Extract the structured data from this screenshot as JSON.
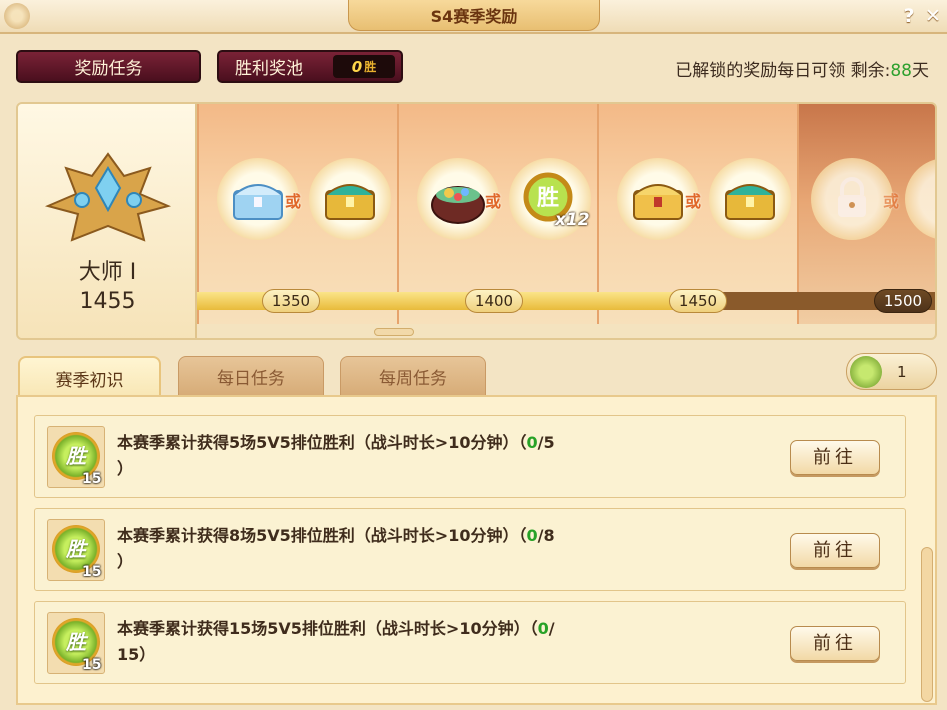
{
  "window": {
    "title": "S4赛季奖励",
    "help_label": "?",
    "close_label": "✕"
  },
  "top": {
    "reward_task_label": "奖励任务",
    "win_pool_label": "胜利奖池",
    "win_pool_count": "0",
    "win_pool_unit": "胜",
    "days_prefix": "已解锁的奖励每日可领 剩余:",
    "days_value": "88",
    "days_suffix": "天"
  },
  "rank": {
    "name": "大师 I",
    "score": "1455"
  },
  "track": {
    "or_label": "或",
    "milestones": [
      "1350",
      "1400",
      "1450",
      "1500"
    ],
    "progress_fraction": 0.709,
    "rewards": [
      {
        "left": "diamond-chest-icon",
        "right": "jade-chest-icon"
      },
      {
        "left": "treasure-pot-icon",
        "right": "win-medal-x12-icon",
        "right_badge": "x12"
      },
      {
        "left": "gold-chest-icon",
        "right": "jade-chest-icon"
      },
      {
        "left": "locked-reward-icon",
        "right": "locked-reward-icon"
      }
    ]
  },
  "tabs": [
    {
      "label": "赛季初识",
      "active": true
    },
    {
      "label": "每日任务",
      "active": false
    },
    {
      "label": "每周任务",
      "active": false
    }
  ],
  "key_count": "1",
  "tasks": [
    {
      "medal_glyph": "胜",
      "reward_count": "15",
      "line1": "本赛季累计获得5场5V5排位胜利（战斗时长>10分钟）（",
      "progress": "0",
      "line1_end": "/5",
      "line2": "）",
      "go_label": "前往"
    },
    {
      "medal_glyph": "胜",
      "reward_count": "15",
      "line1": "本赛季累计获得8场5V5排位胜利（战斗时长>10分钟）（",
      "progress": "0",
      "line1_end": "/8",
      "line2": "）",
      "go_label": "前往"
    },
    {
      "medal_glyph": "胜",
      "reward_count": "15",
      "line1": "本赛季累计获得15场5V5排位胜利（战斗时长>10分钟）（",
      "progress": "0",
      "line1_end": "/",
      "line2": "15）",
      "go_label": "前往"
    }
  ],
  "colors": {
    "accent": "#4a0f1e",
    "progress_green": "#27a227",
    "gold": "#e8bb3b"
  }
}
